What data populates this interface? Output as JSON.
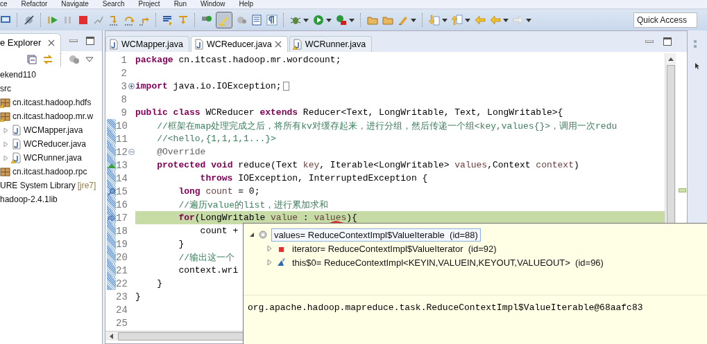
{
  "menu_bar": [
    "ce",
    "Refactor",
    "Navigate",
    "Search",
    "Project",
    "Run",
    "Window",
    "Help"
  ],
  "quick_access": {
    "placeholder": "Quick Access"
  },
  "explorer": {
    "title": "e Explorer",
    "tree": [
      {
        "label": "ekend110",
        "children": [
          {
            "label": "src",
            "children": [
              {
                "label": "cn.itcast.hadoop.hdfs",
                "kind": "package",
                "warning": true
              },
              {
                "label": "cn.itcast.hadoop.mr.w",
                "kind": "package",
                "warning": true,
                "children": [
                  {
                    "label": "WCMapper.java",
                    "kind": "java",
                    "warning": false
                  },
                  {
                    "label": "WCReducer.java",
                    "kind": "java",
                    "warning": false
                  },
                  {
                    "label": "WCRunner.java",
                    "kind": "java",
                    "warning": true
                  }
                ]
              },
              {
                "label": "cn.itcast.hadoop.rpc",
                "kind": "package",
                "warning": false
              }
            ]
          },
          {
            "label": "URE System Library",
            "decoration": "[jre7]"
          },
          {
            "label": "hadoop-2.4.1lib"
          }
        ]
      }
    ]
  },
  "editor": {
    "tabs": [
      {
        "label": "WCMapper.java",
        "selected": false,
        "warning": false
      },
      {
        "label": "WCReducer.java",
        "selected": true,
        "warning": false
      },
      {
        "label": "WCRunner.java",
        "selected": false,
        "warning": true
      }
    ],
    "lines": [
      {
        "number": "1",
        "changed": false,
        "current": false,
        "foldable": false,
        "folded": false,
        "override": false,
        "occurrence": false,
        "tokens": [
          {
            "kind": "kw",
            "text": "package"
          },
          {
            "kind": "plain",
            "text": " cn.itcast.hadoop.mr.wordcount;"
          }
        ]
      },
      {
        "number": "2",
        "changed": false,
        "current": false,
        "foldable": false,
        "folded": false,
        "override": false,
        "occurrence": false
      },
      {
        "number": "3",
        "changed": false,
        "current": false,
        "foldable": true,
        "folded": true,
        "override": false,
        "occurrence": false,
        "tokens": [
          {
            "kind": "kw",
            "text": "import"
          },
          {
            "kind": "plain",
            "text": " java.io.IOException;"
          }
        ]
      },
      {
        "number": "8",
        "changed": false,
        "current": false,
        "foldable": false,
        "folded": false,
        "override": false,
        "occurrence": false
      },
      {
        "number": "9",
        "changed": false,
        "current": false,
        "foldable": false,
        "folded": false,
        "override": false,
        "occurrence": false,
        "tokens": [
          {
            "kind": "kw",
            "text": "public"
          },
          {
            "kind": "kw",
            "text": " class"
          },
          {
            "kind": "plain",
            "text": " WCReducer "
          },
          {
            "kind": "kw",
            "text": "extends"
          },
          {
            "kind": "plain",
            "text": " Reducer<Text, LongWritable, Text, LongWritable>{"
          }
        ]
      },
      {
        "number": "10",
        "changed": true,
        "current": false,
        "foldable": false,
        "folded": false,
        "override": false,
        "occurrence": false,
        "tokens": [
          {
            "kind": "comment",
            "text": "    //框架在map处理完成之后，将所有kv对缓存起来，进行分组，然后传递一个组<key,values{}>，调用一次redu"
          }
        ]
      },
      {
        "number": "11",
        "changed": true,
        "current": false,
        "foldable": false,
        "folded": false,
        "override": false,
        "occurrence": false,
        "tokens": [
          {
            "kind": "comment",
            "text": "    //<hello,{1,1,1,1...}>"
          }
        ]
      },
      {
        "number": "12",
        "changed": true,
        "current": false,
        "foldable": true,
        "folded": false,
        "override": false,
        "occurrence": false,
        "tokens": [
          {
            "kind": "annotation",
            "text": "    @Override"
          }
        ]
      },
      {
        "number": "13",
        "changed": true,
        "current": false,
        "foldable": false,
        "folded": false,
        "override": true,
        "occurrence": false,
        "tokens": [
          {
            "kind": "kw",
            "text": "    protected"
          },
          {
            "kind": "kw",
            "text": " void"
          },
          {
            "kind": "plain",
            "text": " reduce(Text "
          },
          {
            "kind": "var",
            "text": "key"
          },
          {
            "kind": "plain",
            "text": ", Iterable<LongWritable> "
          },
          {
            "kind": "var",
            "text": "values"
          },
          {
            "kind": "plain",
            "text": ",Context "
          },
          {
            "kind": "var",
            "text": "context"
          },
          {
            "kind": "plain",
            "text": ")"
          }
        ]
      },
      {
        "number": "14",
        "changed": true,
        "current": false,
        "foldable": false,
        "folded": false,
        "override": false,
        "occurrence": false,
        "tokens": [
          {
            "kind": "kw",
            "text": "            throws"
          },
          {
            "kind": "plain",
            "text": " IOException, InterruptedException {"
          }
        ]
      },
      {
        "number": "15",
        "changed": true,
        "current": false,
        "foldable": false,
        "folded": false,
        "override": false,
        "occurrence": true,
        "tokens": [
          {
            "kind": "kw",
            "text": "        long"
          },
          {
            "kind": "var",
            "text": " count"
          },
          {
            "kind": "plain",
            "text": " = 0;"
          }
        ]
      },
      {
        "number": "16",
        "changed": true,
        "current": false,
        "foldable": false,
        "folded": false,
        "override": false,
        "occurrence": false,
        "tokens": [
          {
            "kind": "comment",
            "text": "        //遍历value的list，进行累加求和"
          }
        ]
      },
      {
        "number": "17",
        "changed": true,
        "current": true,
        "foldable": false,
        "folded": false,
        "override": false,
        "occurrence": false,
        "tokens": [
          {
            "kind": "kw",
            "text": "        for"
          },
          {
            "kind": "plain",
            "text": "(LongWritable "
          },
          {
            "kind": "var",
            "text": "value"
          },
          {
            "kind": "plain",
            "text": " : "
          },
          {
            "kind": "var",
            "text": "values"
          },
          {
            "kind": "plain",
            "text": "){"
          }
        ]
      },
      {
        "number": "18",
        "changed": true,
        "current": false,
        "foldable": false,
        "folded": false,
        "override": false,
        "occurrence": false,
        "tokens": [
          {
            "kind": "plain",
            "text": "            count +"
          }
        ]
      },
      {
        "number": "19",
        "changed": true,
        "current": false,
        "foldable": false,
        "folded": false,
        "override": false,
        "occurrence": false,
        "tokens": [
          {
            "kind": "plain",
            "text": "        }"
          }
        ]
      },
      {
        "number": "20",
        "changed": true,
        "current": false,
        "foldable": false,
        "folded": false,
        "override": false,
        "occurrence": false,
        "tokens": [
          {
            "kind": "comment",
            "text": "        //输出这一个"
          }
        ]
      },
      {
        "number": "21",
        "changed": true,
        "current": false,
        "foldable": false,
        "folded": false,
        "override": false,
        "occurrence": false,
        "tokens": [
          {
            "kind": "plain",
            "text": "        context.wri"
          }
        ]
      },
      {
        "number": "22",
        "changed": true,
        "current": false,
        "foldable": false,
        "folded": false,
        "override": false,
        "occurrence": false,
        "tokens": [
          {
            "kind": "plain",
            "text": "    }"
          }
        ]
      },
      {
        "number": "23",
        "changed": false,
        "current": false,
        "foldable": false,
        "folded": false,
        "override": false,
        "occurrence": false,
        "tokens": [
          {
            "kind": "plain",
            "text": "}"
          }
        ]
      },
      {
        "number": "24",
        "changed": false,
        "current": false,
        "foldable": false,
        "folded": false,
        "override": false,
        "occurrence": false
      },
      {
        "number": "25",
        "changed": false,
        "current": false,
        "foldable": false,
        "folded": false,
        "override": false,
        "occurrence": false
      }
    ]
  },
  "inspect_popup": {
    "tree": [
      {
        "name": "values= ReduceContextImpl$ValueIterable",
        "id": "(id=88)",
        "kind": "local",
        "selected": true,
        "expanded": true,
        "children": [
          {
            "name": "iterator= ReduceContextImpl$ValueIterator",
            "id": "(id=92)",
            "kind": "private",
            "selected": false,
            "expanded": false
          },
          {
            "name": "this$0= ReduceContextImpl<KEYIN,VALUEIN,KEYOUT,VALUEOUT>",
            "id": "(id=96)",
            "kind": "final",
            "selected": false,
            "expanded": false
          }
        ]
      }
    ],
    "detail": "org.apache.hadoop.mapreduce.task.ReduceContextImpl$ValueIterable@68aafc83"
  }
}
